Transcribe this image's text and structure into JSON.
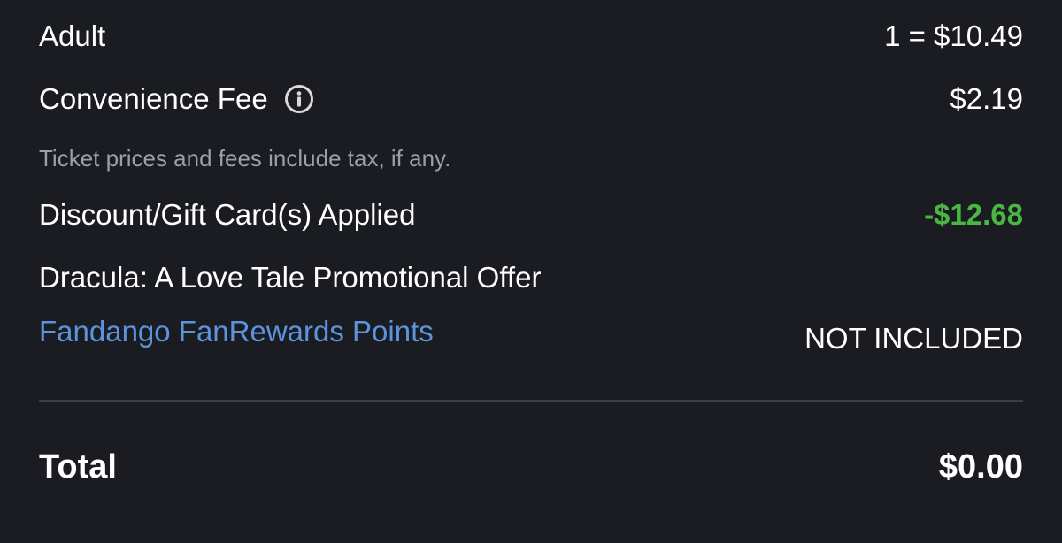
{
  "order_summary": {
    "adult": {
      "label": "Adult",
      "value": "1 = $10.49"
    },
    "convenience_fee": {
      "label": "Convenience Fee",
      "value": "$2.19",
      "icon": "info-icon"
    },
    "tax_note": "Ticket prices and fees include tax, if any.",
    "discount": {
      "label": "Discount/Gift Card(s) Applied",
      "value": "-$12.68",
      "color": "#4bb543"
    },
    "promo": {
      "label": "Dracula: A Love Tale Promotional Offer"
    },
    "fanrewards": {
      "label": "Fandango FanRewards Points",
      "value": "NOT INCLUDED",
      "link_color": "#5b93dc"
    },
    "total": {
      "label": "Total",
      "value": "$0.00"
    }
  },
  "colors": {
    "background": "#1a1c21",
    "text": "#ffffff",
    "muted": "#9aa0a6",
    "divider": "#3a3e45"
  }
}
